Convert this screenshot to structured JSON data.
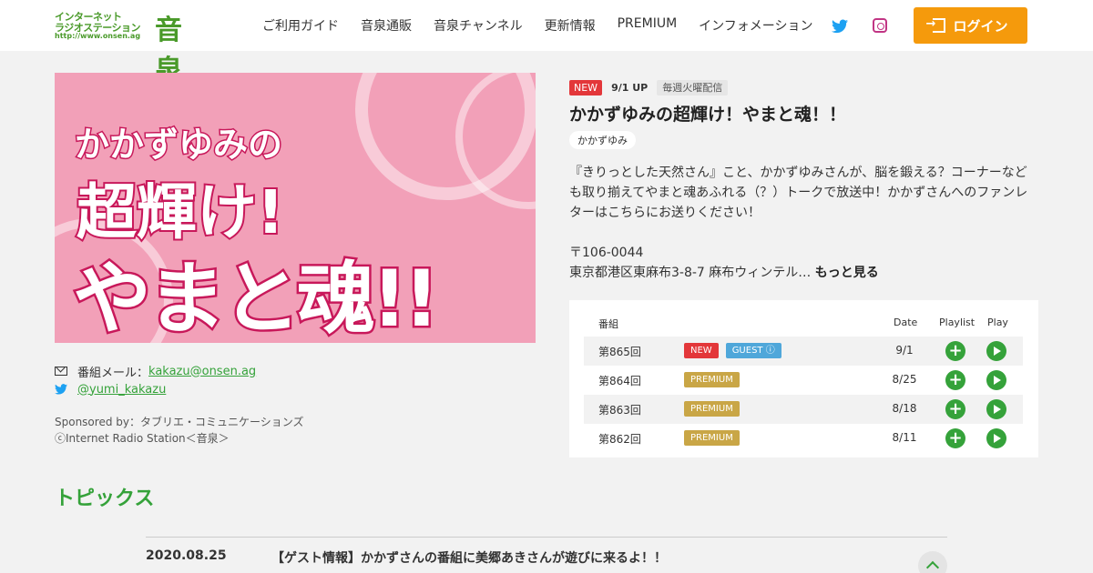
{
  "header": {
    "logo": {
      "line1": "インターネット",
      "line2": "ラジオステーション",
      "url": "http://www.onsen.ag",
      "kanji": "音泉"
    },
    "nav": [
      "ご利用ガイド",
      "音泉通販",
      "音泉チャンネル",
      "更新情報",
      "PREMIUM",
      "インフォメーション"
    ],
    "login_label": "ログイン",
    "icons": {
      "twitter": "twitter-icon",
      "instagram": "instagram-icon",
      "login": "login-icon"
    },
    "colors": {
      "accent": "#f59a0c",
      "brand": "#35a23a"
    }
  },
  "program": {
    "banner": {
      "line1": "かかずゆみの",
      "line2": "超輝け!",
      "line3": "やまと魂!!"
    },
    "badge_new": "NEW",
    "update": "9/1 UP",
    "schedule": "毎週火曜配信",
    "title": "かかずゆみの超輝け！やまと魂！！",
    "cast": "かかずゆみ",
    "description": "『きりっとした天然さん』こと、かかずゆみさんが、脳を鍛える？コーナーなども取り揃えてやまと魂あふれる（？）トークで放送中！かかずさんへのファンレターはこちらにお送りください！",
    "postal": "〒106-0044",
    "address": "東京都港区東麻布3-8-7 麻布ウィンテル…",
    "more": "もっと見る",
    "contact": {
      "mail_label": "番組メール：",
      "mail": "kakazu@onsen.ag",
      "twitter": "@yumi_kakazu"
    },
    "sponsor": "Sponsored by：タブリエ・コミュニケーションズ",
    "copyright": "ⓒInternet Radio Station＜音泉＞"
  },
  "episodes": {
    "headers": {
      "program": "番組",
      "date": "Date",
      "playlist": "Playlist",
      "play": "Play"
    },
    "rows": [
      {
        "ep": "第865回",
        "tag1": "NEW",
        "tag2": "GUEST ⓘ",
        "date": "9/1"
      },
      {
        "ep": "第864回",
        "tag1": "PREMIUM",
        "date": "8/25"
      },
      {
        "ep": "第863回",
        "tag1": "PREMIUM",
        "date": "8/18"
      },
      {
        "ep": "第862回",
        "tag1": "PREMIUM",
        "date": "8/11"
      }
    ]
  },
  "topics": {
    "heading": "トピックス",
    "items": [
      {
        "date": "2020.08.25",
        "title": "【ゲスト情報】かかずさんの番組に美郷あきさんが遊びに来るよ！！"
      }
    ]
  }
}
